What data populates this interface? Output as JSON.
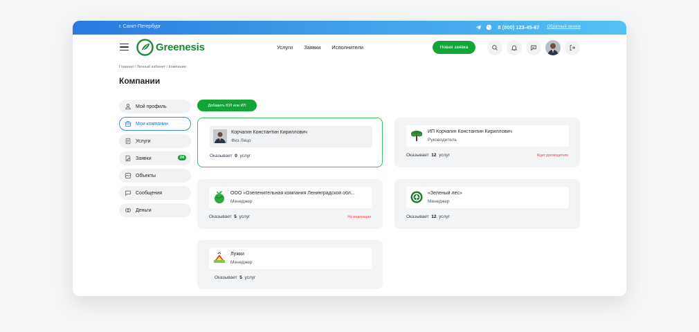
{
  "topbar": {
    "city": "г. Санкт-Петербург",
    "phone": "8 (800) 123-45-67",
    "callback": "Обратный звонок",
    "telegram_icon": "telegram-icon",
    "whatsapp_icon": "whatsapp-icon"
  },
  "header": {
    "logo_text": "Greenesis",
    "nav": [
      "Услуги",
      "Заявки",
      "Исполнители"
    ],
    "new_order_label": "Новая заявка",
    "icons": [
      "search-icon",
      "bell-icon",
      "chat-icon",
      "avatar",
      "logout-icon"
    ]
  },
  "breadcrumb": {
    "items": [
      "Главная",
      "Личный кабинет",
      "Компании"
    ],
    "separator": "/"
  },
  "page_title": "Компании",
  "sidebar": {
    "items": [
      {
        "label": "Мой профиль",
        "icon": "user-icon",
        "active": false
      },
      {
        "label": "Мои компании",
        "icon": "briefcase-icon",
        "active": true
      },
      {
        "label": "Услуги",
        "icon": "document-icon",
        "active": false
      },
      {
        "label": "Заявки",
        "icon": "edit-document-icon",
        "active": false,
        "badge": "24"
      },
      {
        "label": "Объекты",
        "icon": "map-icon",
        "active": false
      },
      {
        "label": "Сообщения",
        "icon": "chat-icon",
        "active": false
      },
      {
        "label": "Деньги",
        "icon": "coins-icon",
        "active": false
      }
    ]
  },
  "add_company_label": "Добавить ЮЛ или ИП",
  "companies": [
    {
      "name": "Корчагин Константин Кириллович",
      "role": "Физ Лицо",
      "services_prefix": "Оказывает",
      "services_count": "0",
      "services_suffix": "услуг",
      "status": "",
      "logo": "person-photo"
    },
    {
      "name": "ИП Корчагин Константин Кириллович",
      "role": "Руководитель",
      "services_prefix": "Оказывает",
      "services_count": "12",
      "services_suffix": "услуг",
      "status": "Ждет руководителя",
      "logo": "tree-logo"
    },
    {
      "name": "ООО «Озеленительная компания Ленинградской обл...",
      "role": "Менеджер",
      "services_prefix": "Оказывает",
      "services_count": "5",
      "services_suffix": "услуг",
      "status": "На модерации",
      "logo": "green-globe-logo"
    },
    {
      "name": "«Зеленый лес»",
      "role": "Менеджер",
      "services_prefix": "Оказывает",
      "services_count": "12",
      "services_suffix": "услуг",
      "status": "",
      "logo": "green-forest-logo"
    },
    {
      "name": "Лужки",
      "role": "Менеджер",
      "services_prefix": "Оказывает",
      "services_count": "5",
      "services_suffix": "услуг",
      "status": "",
      "logo": "meadow-logo"
    }
  ],
  "colors": {
    "brand_green": "#13a538",
    "accent_blue": "#3a86e6",
    "status_red": "#e5484d"
  }
}
